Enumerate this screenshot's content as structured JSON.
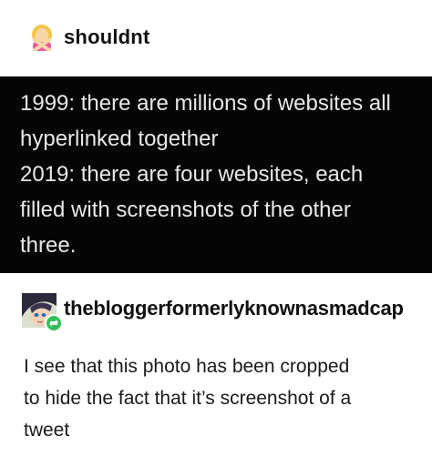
{
  "post": {
    "author": "shouldnt",
    "avatar_icon": "woman-gesturing-no-emoji",
    "quote_lines": [
      "1999: there are millions of websites all",
      "hyperlinked together",
      "2019: there are four websites, each",
      "filled with screenshots of the other",
      "three."
    ]
  },
  "reply": {
    "author": "thebloggerformerlyknownasmadcap",
    "avatar_icon": "anime-character-avatar",
    "badge_icon": "reblog-icon",
    "text_lines": [
      "I see that this photo has been cropped",
      "to hide the fact that it’s screenshot of a",
      "tweet"
    ]
  },
  "colors": {
    "quote_background": "#050505",
    "quote_text": "#e8e8e8",
    "reblog_badge": "#33c05b"
  }
}
